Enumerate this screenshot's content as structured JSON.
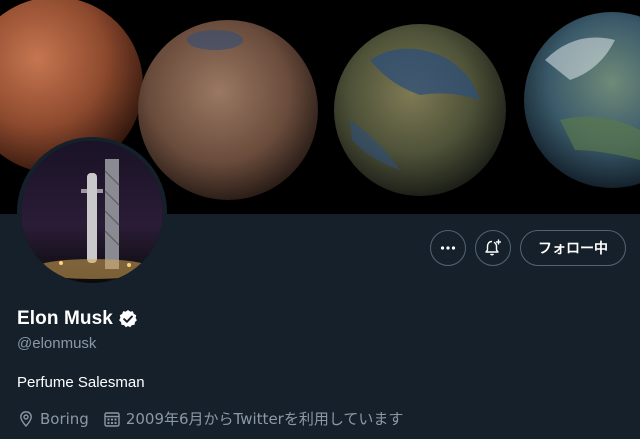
{
  "profile": {
    "display_name": "Elon Musk",
    "handle": "@elonmusk",
    "verified": true,
    "bio": "Perfume Salesman",
    "location": "Boring",
    "joined": "2009年6月からTwitterを利用しています"
  },
  "actions": {
    "more_icon": "more-dots-icon",
    "notify_icon": "bell-plus-icon",
    "follow_label": "フォロー中"
  },
  "banner": {
    "description_icons": [
      "mars-planet",
      "terraforming-mars-planet",
      "terraformed-mars-planet",
      "earth-like-planet"
    ]
  },
  "colors": {
    "background": "#15202b",
    "secondary_text": "#8b98a5",
    "border": "#536471",
    "verified_badge": "#ffffff"
  }
}
